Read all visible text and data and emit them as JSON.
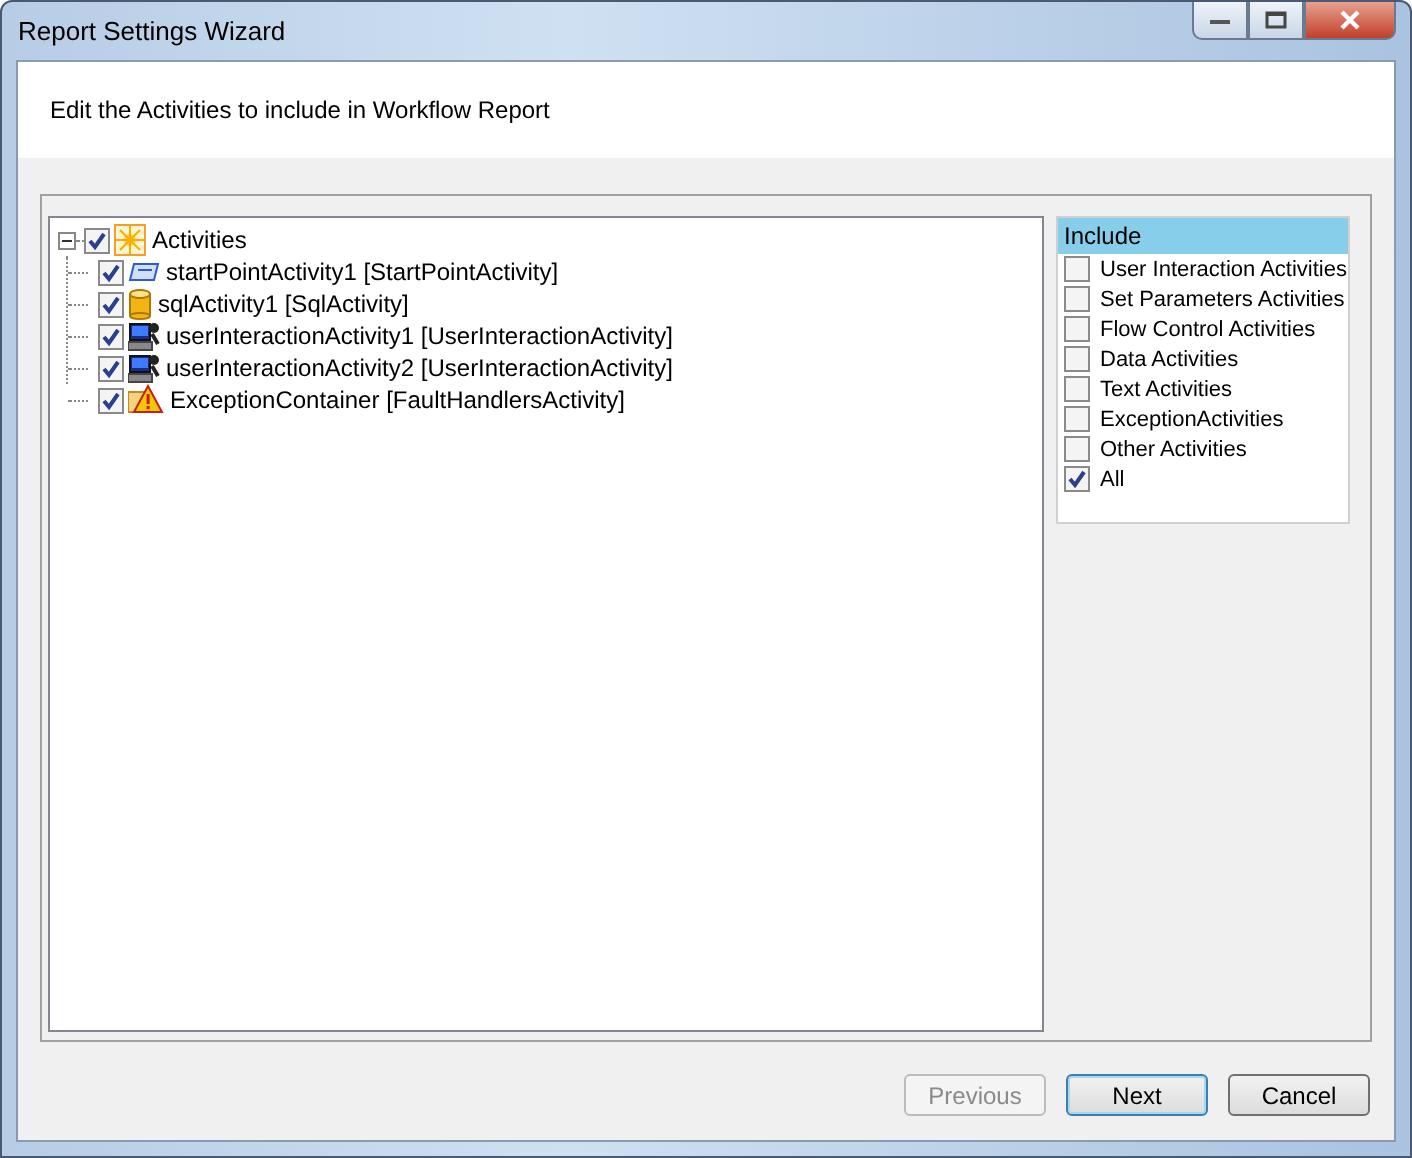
{
  "window": {
    "title": "Report Settings Wizard"
  },
  "header": {
    "text": "Edit the Activities to include in Workflow Report"
  },
  "tree": {
    "label": "Activities",
    "kind": "root",
    "checked": true,
    "expanded": true,
    "children": [
      {
        "label": "startPointActivity1 [StartPointActivity]",
        "kind": "start",
        "checked": true
      },
      {
        "label": "sqlActivity1 [SqlActivity]",
        "kind": "sql",
        "checked": true
      },
      {
        "label": "userInteractionActivity1 [UserInteractionActivity]",
        "kind": "user",
        "checked": true
      },
      {
        "label": "userInteractionActivity2 [UserInteractionActivity]",
        "kind": "user",
        "checked": true
      },
      {
        "label": "ExceptionContainer [FaultHandlersActivity]",
        "kind": "fault",
        "checked": true
      }
    ]
  },
  "include": {
    "header": "Include",
    "items": [
      {
        "label": "User Interaction Activities",
        "checked": false
      },
      {
        "label": "Set Parameters Activities",
        "checked": false
      },
      {
        "label": "Flow Control Activities",
        "checked": false
      },
      {
        "label": "Data Activities",
        "checked": false
      },
      {
        "label": "Text Activities",
        "checked": false
      },
      {
        "label": "ExceptionActivities",
        "checked": false
      },
      {
        "label": "Other Activities",
        "checked": false
      },
      {
        "label": "All",
        "checked": true
      }
    ]
  },
  "buttons": [
    {
      "label": "Previous",
      "disabled": true,
      "focused": false
    },
    {
      "label": "Next",
      "disabled": false,
      "focused": true
    },
    {
      "label": "Cancel",
      "disabled": false,
      "focused": false
    }
  ]
}
